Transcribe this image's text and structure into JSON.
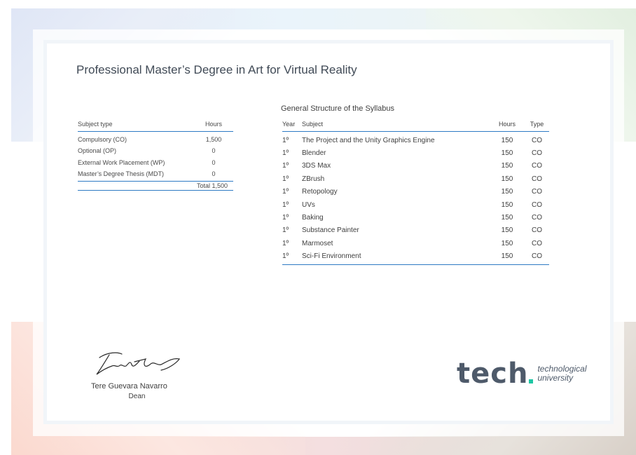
{
  "title": "Professional Master’s Degree in Art for Virtual Reality",
  "summary_table": {
    "headers": [
      "Subject type",
      "Hours"
    ],
    "rows": [
      {
        "type": "Compulsory (CO)",
        "hours": "1,500"
      },
      {
        "type": "Optional (OP)",
        "hours": "0"
      },
      {
        "type": "External Work Placement (WP)",
        "hours": "0"
      },
      {
        "type": "Master’s Degree Thesis (MDT)",
        "hours": "0"
      }
    ],
    "total": "Total 1,500"
  },
  "syllabus": {
    "title": "General Structure of the Syllabus",
    "headers": [
      "Year",
      "Subject",
      "Hours",
      "Type"
    ],
    "rows": [
      {
        "year": "1º",
        "subject": "The Project and the Unity Graphics Engine",
        "hours": "150",
        "type": "CO"
      },
      {
        "year": "1º",
        "subject": "Blender",
        "hours": "150",
        "type": "CO"
      },
      {
        "year": "1º",
        "subject": "3DS Max",
        "hours": "150",
        "type": "CO"
      },
      {
        "year": "1º",
        "subject": "ZBrush",
        "hours": "150",
        "type": "CO"
      },
      {
        "year": "1º",
        "subject": "Retopology",
        "hours": "150",
        "type": "CO"
      },
      {
        "year": "1º",
        "subject": "UVs",
        "hours": "150",
        "type": "CO"
      },
      {
        "year": "1º",
        "subject": "Baking",
        "hours": "150",
        "type": "CO"
      },
      {
        "year": "1º",
        "subject": "Substance Painter",
        "hours": "150",
        "type": "CO"
      },
      {
        "year": "1º",
        "subject": "Marmoset",
        "hours": "150",
        "type": "CO"
      },
      {
        "year": "1º",
        "subject": "Sci-Fi Environment",
        "hours": "150",
        "type": "CO"
      }
    ]
  },
  "signature": {
    "name": "Tere Guevara Navarro",
    "role": "Dean"
  },
  "logo": {
    "word": "tech",
    "line1": "technological",
    "line2": "university"
  },
  "colors": {
    "accent": "#2e7bc4",
    "logo_text": "#4e5a6a",
    "logo_accent": "#1ec6a4"
  }
}
